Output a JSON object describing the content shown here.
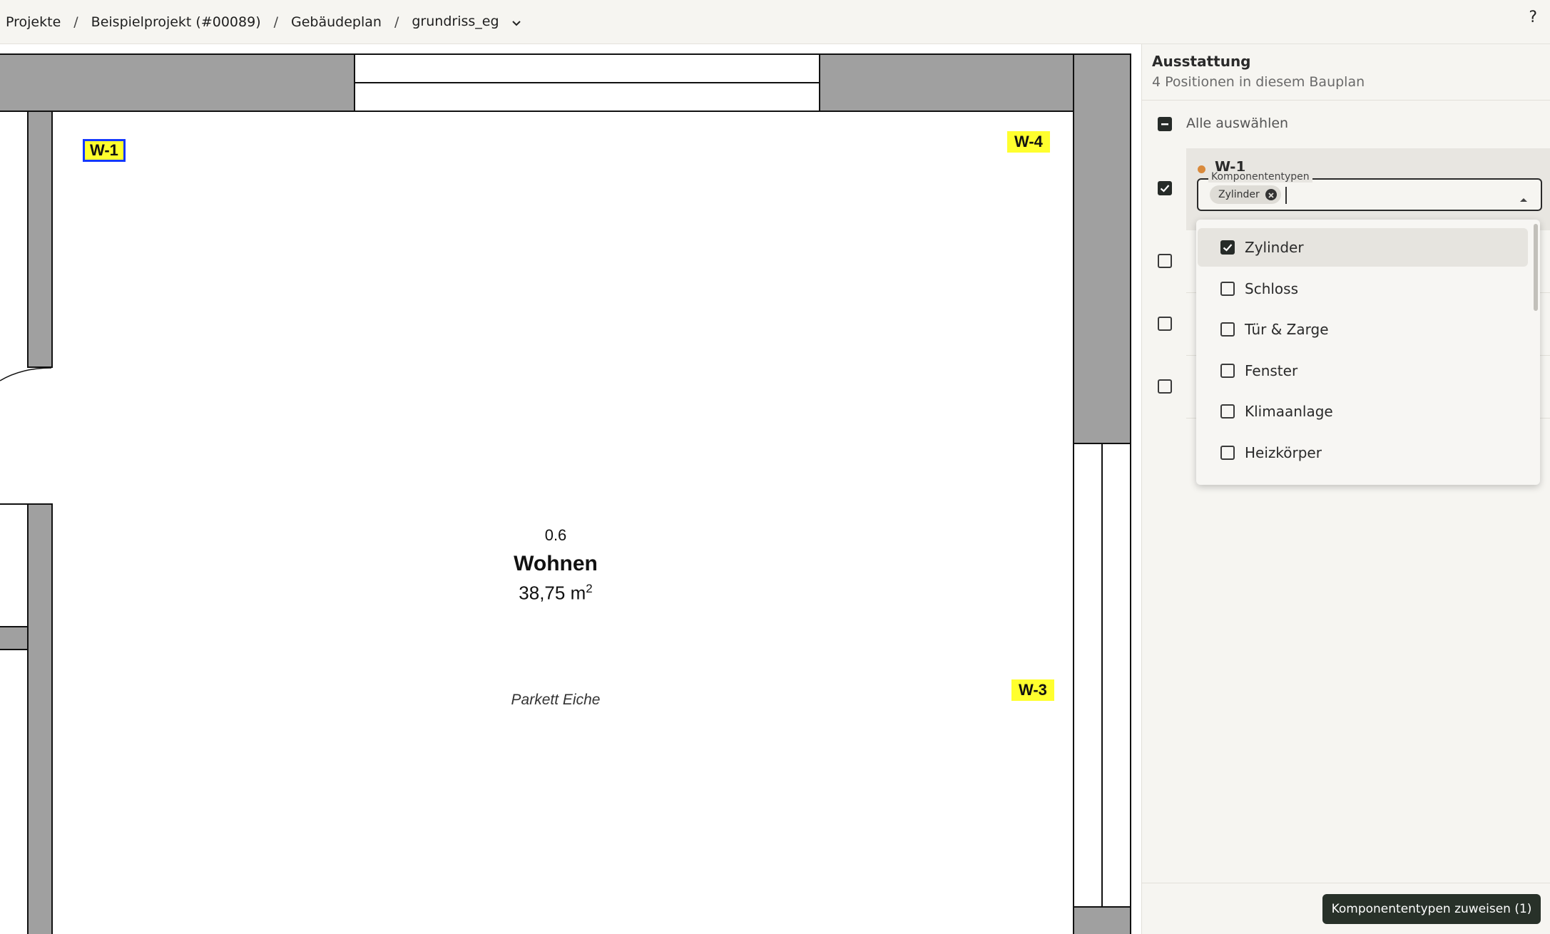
{
  "breadcrumb": {
    "items": [
      "Projekte",
      "Beispielprojekt (#00089)",
      "Gebäudeplan",
      "grundriss_eg"
    ],
    "separator": "/"
  },
  "header": {
    "help_label": "?"
  },
  "plan": {
    "tags": [
      "W-1",
      "W-4",
      "W-3"
    ],
    "room": {
      "number": "0.6",
      "name": "Wohnen",
      "area_value": "38,75 m",
      "area_exp": "2",
      "floor": "Parkett Eiche"
    }
  },
  "panel": {
    "title": "Ausstattung",
    "subtitle": "4 Positionen in diesem Bauplan",
    "select_all_label": "Alle auswählen",
    "item": {
      "name": "W-1",
      "dot_color": "#d98a3c",
      "field_label": "Komponententypen",
      "selected_chips": [
        "Zylinder"
      ]
    },
    "dropdown_options": [
      {
        "label": "Zylinder",
        "checked": true
      },
      {
        "label": "Schloss",
        "checked": false
      },
      {
        "label": "Tür & Zarge",
        "checked": false
      },
      {
        "label": "Fenster",
        "checked": false
      },
      {
        "label": "Klimaanlage",
        "checked": false
      },
      {
        "label": "Heizkörper",
        "checked": false
      }
    ],
    "assign_button_label": "Komponententypen zuweisen (1)"
  },
  "colors": {
    "accent": "#283129",
    "highlight_tag": "#ffff2e",
    "selected_tag_border": "#1438ff",
    "wall": "#a0a0a0"
  }
}
